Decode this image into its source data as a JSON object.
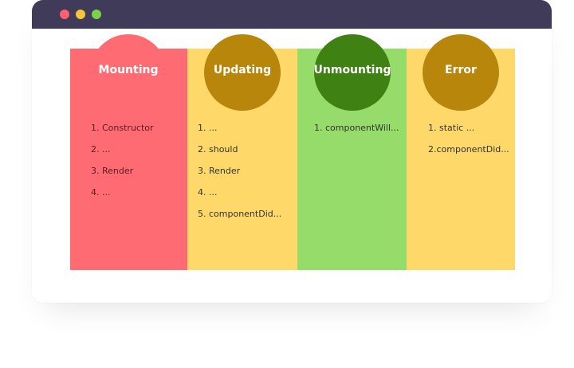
{
  "window": {
    "controls": [
      "close",
      "minimize",
      "maximize"
    ]
  },
  "colors": {
    "titlebar": "#3f3b58",
    "mounting_bg": "#ff6b72",
    "mounting_circle": "#ff6b72",
    "updating_bg": "#fed96a",
    "updating_circle": "#b8860b",
    "unmounting_bg": "#96dc6a",
    "unmounting_circle": "#3f8213",
    "error_bg": "#fed96a",
    "error_circle": "#b8860b"
  },
  "phases": [
    {
      "title": "Mounting",
      "items": [
        "1. Constructor",
        "2. ...",
        "3. Render",
        "4. ..."
      ]
    },
    {
      "title": "Updating",
      "items": [
        "1. ...",
        "2. should",
        "3. Render",
        "4. ...",
        "5. componentDid..."
      ]
    },
    {
      "title": "Unmounting",
      "items": [
        "1. componentWill..."
      ]
    },
    {
      "title": "Error",
      "items": [
        "1. static ...",
        "2.componentDid..."
      ]
    }
  ]
}
